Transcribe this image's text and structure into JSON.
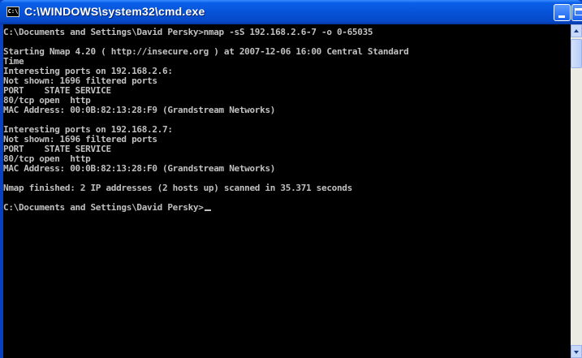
{
  "window": {
    "title": "C:\\WINDOWS\\system32\\cmd.exe",
    "icon": "cmd-window-icon",
    "icon_text": "C:\\",
    "close_glyph": "×"
  },
  "console": {
    "lines": [
      "C:\\Documents and Settings\\David Persky>nmap -sS 192.168.2.6-7 -o 0-65035",
      "",
      "Starting Nmap 4.20 ( http://insecure.org ) at 2007-12-06 16:00 Central Standard",
      "Time",
      "Interesting ports on 192.168.2.6:",
      "Not shown: 1696 filtered ports",
      "PORT    STATE SERVICE",
      "80/tcp open  http",
      "MAC Address: 00:0B:82:13:28:F9 (Grandstream Networks)",
      "",
      "Interesting ports on 192.168.2.7:",
      "Not shown: 1696 filtered ports",
      "PORT    STATE SERVICE",
      "80/tcp open  http",
      "MAC Address: 00:0B:82:13:28:F0 (Grandstream Networks)",
      "",
      "Nmap finished: 2 IP addresses (2 hosts up) scanned in 35.371 seconds",
      "",
      "C:\\Documents and Settings\\David Persky>"
    ]
  },
  "colors": {
    "titlebar": "#0653d8",
    "console_bg": "#000000",
    "console_fg": "#c0c0c0"
  }
}
